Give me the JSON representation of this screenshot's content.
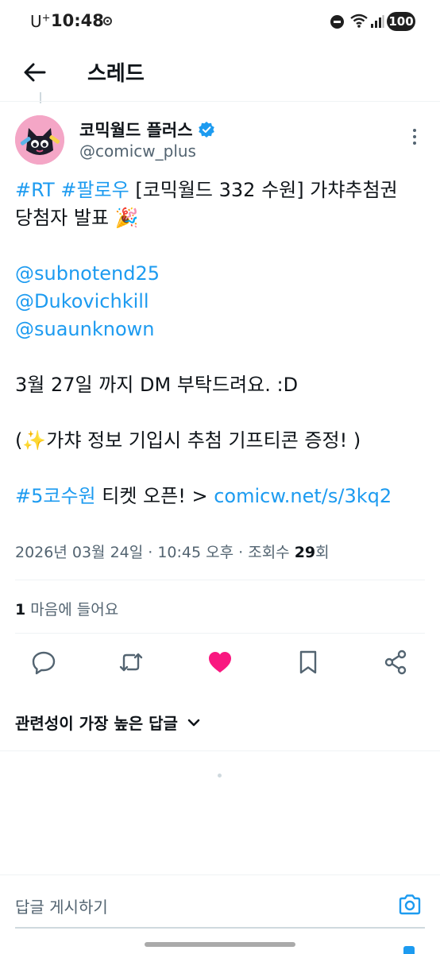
{
  "status_bar": {
    "carrier": "U",
    "carrier_sup": "+",
    "time": "10:48",
    "battery": "100"
  },
  "header": {
    "title": "스레드"
  },
  "tweet": {
    "author_name": "코믹월드 플러스",
    "author_handle": "@comicw_plus",
    "line1_tag1": "#RT",
    "line1_tag2": "#팔로우",
    "line1_text": " [코믹월드 332 수원] 가챠추첨권",
    "line2_text": "당첨자 발표 🎉",
    "mention1": "@subnotend25",
    "mention2": "@Dukovichkill",
    "mention3": "@suaunknown",
    "line_dm": "3월 27일 까지 DM 부탁드려요. :D",
    "line_gift": "(✨가챠 정보 기입시 추첨 기프티콘 증정! )",
    "last_tag": "#5코수원",
    "last_text": " 티켓 오픈! > ",
    "last_link": "comicw.net/s/3kq2",
    "meta_prefix": "2026년 03월 24일 · 10:45 오후 · 조회수 ",
    "views": "29",
    "meta_suffix": "회"
  },
  "engagement": {
    "likes_count": "1",
    "likes_label": " 마음에 들어요",
    "like_color": "#f91880"
  },
  "sort": {
    "label": "관련성이 가장 높은 답글"
  },
  "reply": {
    "placeholder": "답글 게시하기"
  },
  "colors": {
    "link": "#1d9bf0",
    "secondary_text": "#536471"
  },
  "icons": {
    "back": "arrow-left-icon",
    "verified": "verified-badge-icon",
    "more": "more-vertical-icon",
    "reply": "reply-icon",
    "retweet": "retweet-icon",
    "like": "heart-icon",
    "bookmark": "bookmark-icon",
    "share": "share-icon",
    "sort": "chevron-down-icon",
    "camera": "camera-icon"
  }
}
